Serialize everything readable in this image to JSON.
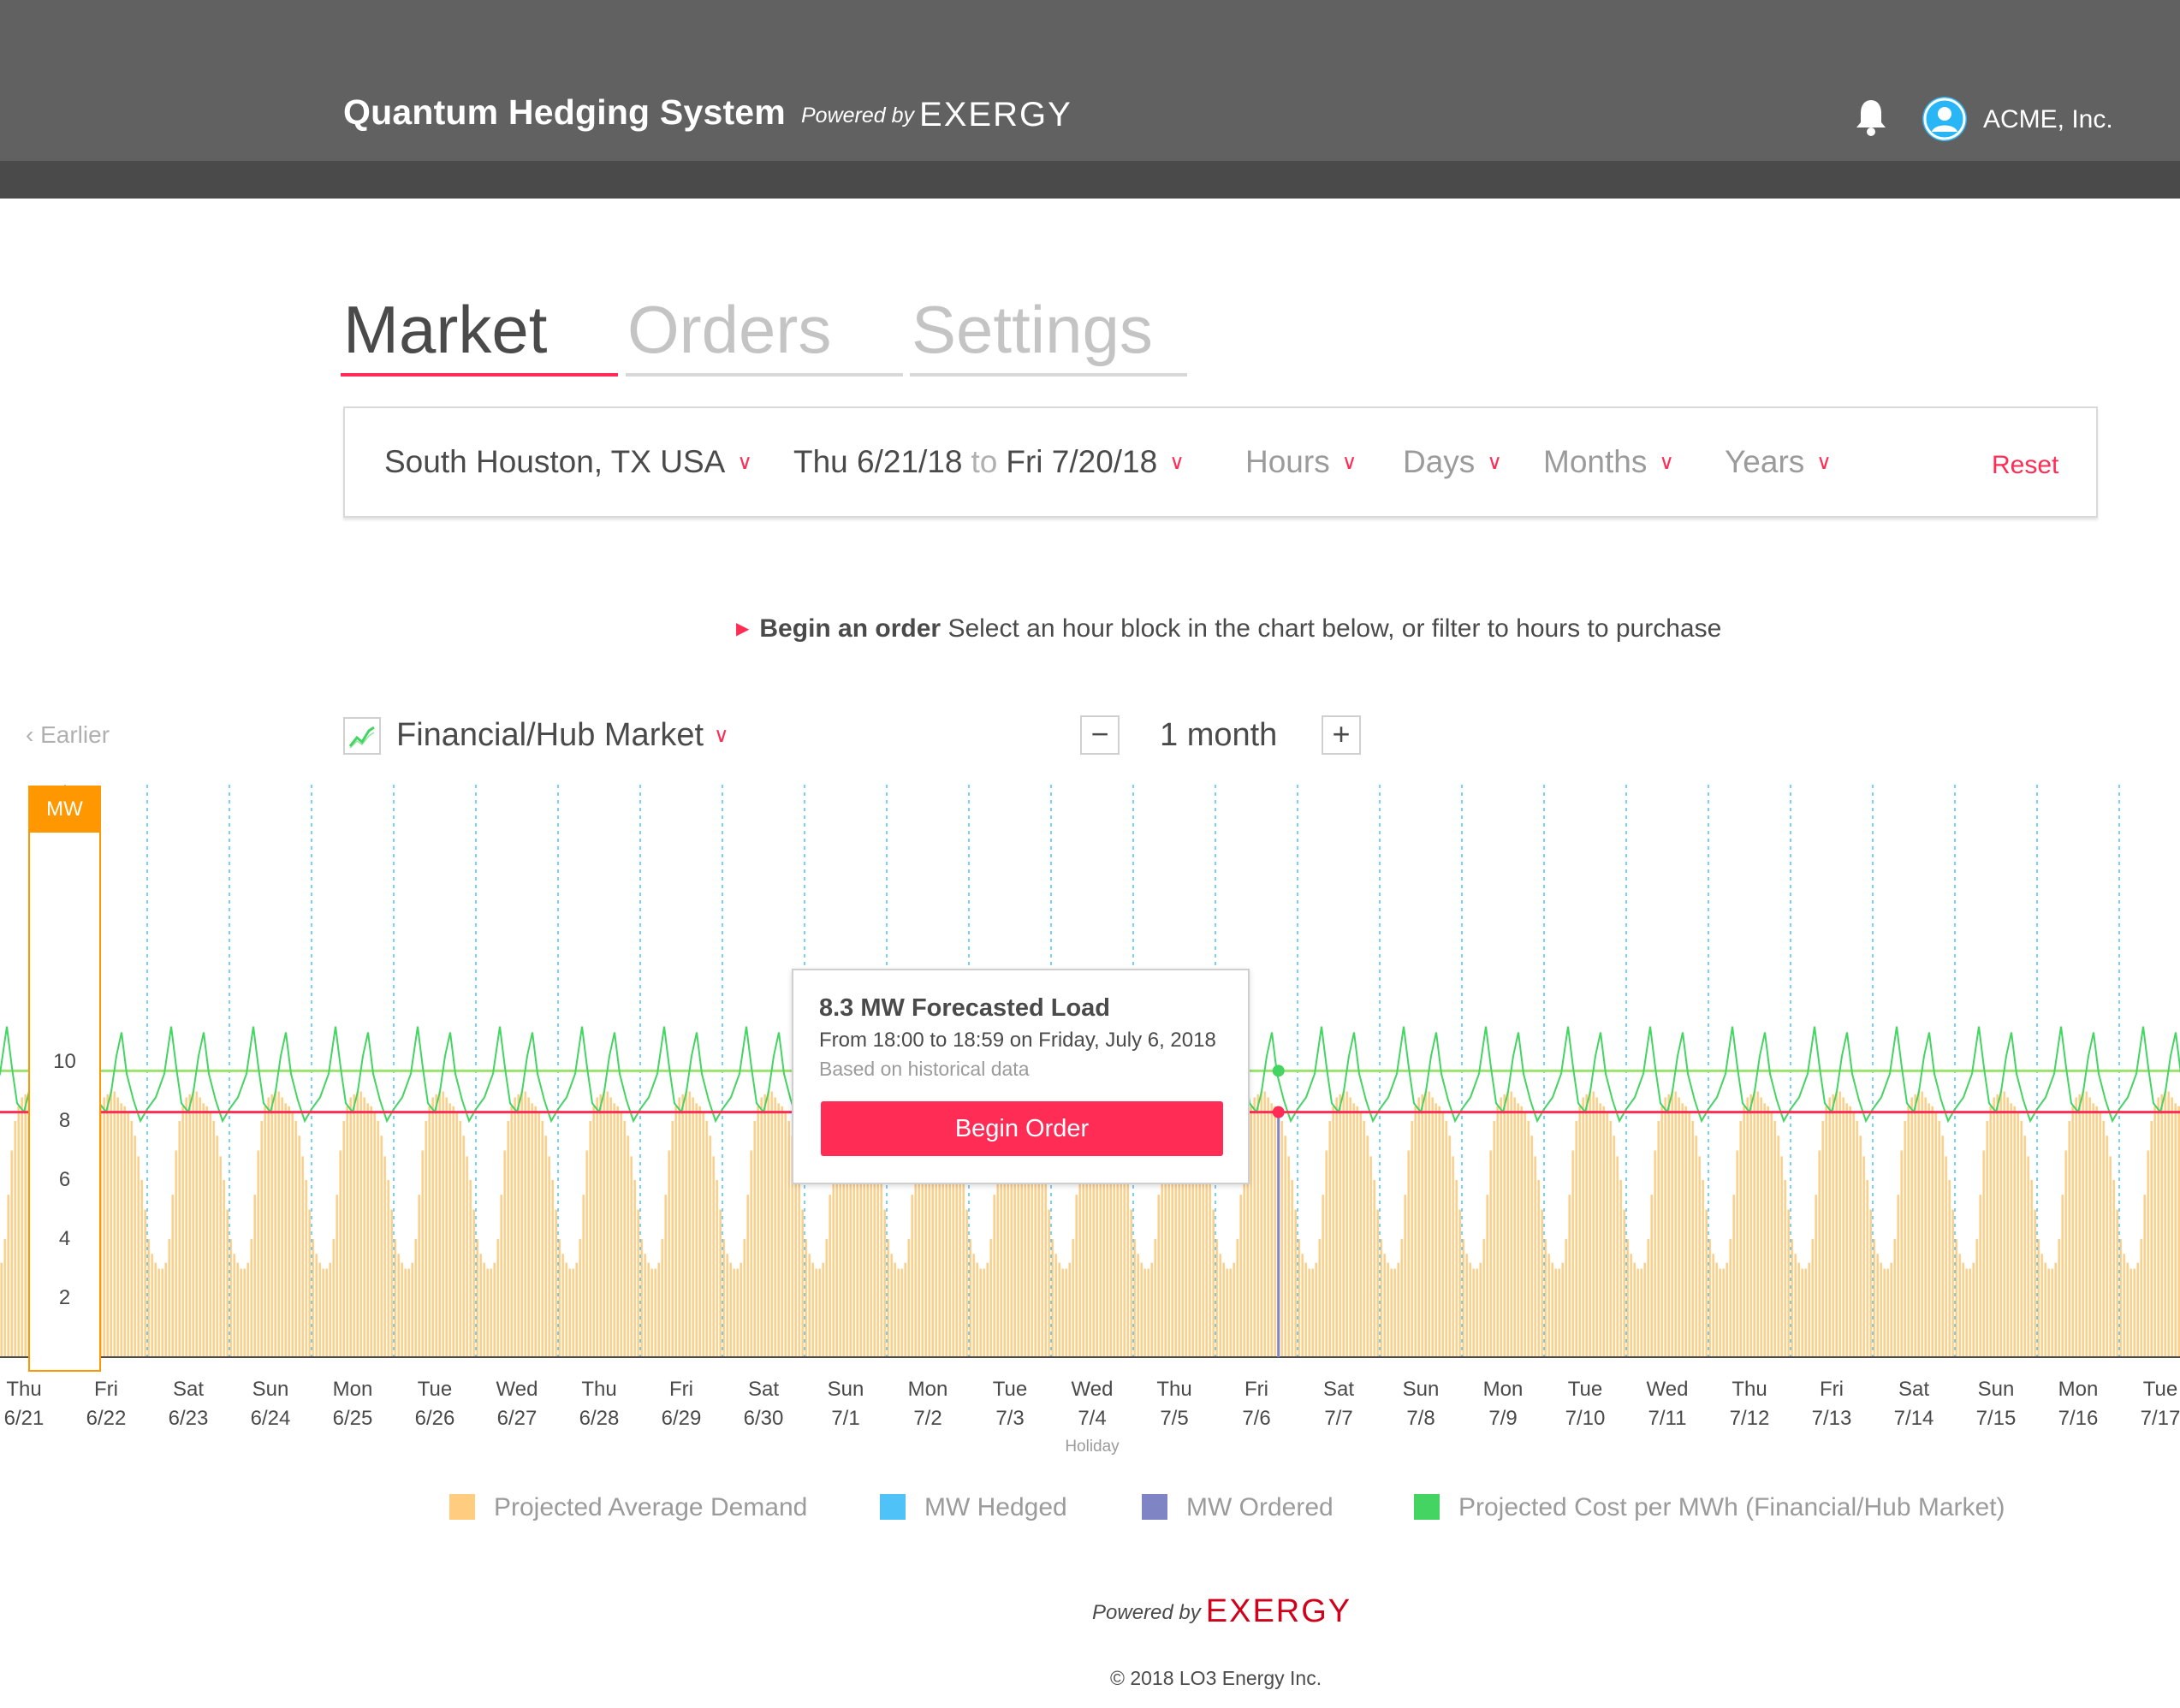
{
  "header": {
    "title": "Quantum Hedging System",
    "powered_prefix": "Powered by",
    "brand": "EXERGY",
    "account_name": "ACME, Inc.",
    "icons": [
      "bell-icon",
      "user-avatar-icon"
    ]
  },
  "tabs": [
    {
      "label": "Market",
      "active": true
    },
    {
      "label": "Orders",
      "active": false
    },
    {
      "label": "Settings",
      "active": false
    }
  ],
  "filter": {
    "location": "South Houston, TX USA",
    "date_from": "Thu 6/21/18",
    "date_sep": "to",
    "date_to": "Fri 7/20/18",
    "hours": "Hours",
    "days": "Days",
    "months": "Months",
    "years": "Years",
    "reset": "Reset"
  },
  "hint": {
    "bold": "Begin an order",
    "text": "Select an hour block in the chart below, or filter to hours to purchase"
  },
  "chart_controls": {
    "earlier": "Earlier",
    "market_select": "Financial/Hub Market",
    "zoom_minus": "−",
    "zoom_value": "1 month",
    "zoom_plus": "+"
  },
  "tooltip": {
    "title": "8.3 MW Forecasted Load",
    "subtitle": "From 18:00 to 18:59 on Friday, July 6, 2018",
    "note": "Based on historical data",
    "button": "Begin Order"
  },
  "chart_data": {
    "type": "bar",
    "y_axis_label": "MW",
    "ylim": [
      0,
      12
    ],
    "y_ticks": [
      2,
      4,
      6,
      8,
      10
    ],
    "grid": "vertical dashed day separators",
    "days": [
      {
        "dow": "Thu",
        "date": "6/21"
      },
      {
        "dow": "Fri",
        "date": "6/22"
      },
      {
        "dow": "Sat",
        "date": "6/23"
      },
      {
        "dow": "Sun",
        "date": "6/24"
      },
      {
        "dow": "Mon",
        "date": "6/25"
      },
      {
        "dow": "Tue",
        "date": "6/26"
      },
      {
        "dow": "Wed",
        "date": "6/27"
      },
      {
        "dow": "Thu",
        "date": "6/28"
      },
      {
        "dow": "Fri",
        "date": "6/29"
      },
      {
        "dow": "Sat",
        "date": "6/30"
      },
      {
        "dow": "Sun",
        "date": "7/1"
      },
      {
        "dow": "Mon",
        "date": "7/2"
      },
      {
        "dow": "Tue",
        "date": "7/3"
      },
      {
        "dow": "Wed",
        "date": "7/4",
        "note": "Holiday"
      },
      {
        "dow": "Thu",
        "date": "7/5"
      },
      {
        "dow": "Fri",
        "date": "7/6"
      },
      {
        "dow": "Sat",
        "date": "7/7"
      },
      {
        "dow": "Sun",
        "date": "7/8"
      },
      {
        "dow": "Mon",
        "date": "7/9"
      },
      {
        "dow": "Tue",
        "date": "7/10"
      },
      {
        "dow": "Wed",
        "date": "7/11"
      },
      {
        "dow": "Thu",
        "date": "7/12"
      },
      {
        "dow": "Fri",
        "date": "7/13"
      },
      {
        "dow": "Sat",
        "date": "7/14"
      },
      {
        "dow": "Sun",
        "date": "7/15"
      },
      {
        "dow": "Mon",
        "date": "7/16"
      },
      {
        "dow": "Tue",
        "date": "7/17"
      }
    ],
    "hourly_demand_profile_mw": [
      4.0,
      3.5,
      3.2,
      3.0,
      3.0,
      3.2,
      4.0,
      5.5,
      7.0,
      8.0,
      8.5,
      8.8,
      8.9,
      9.0,
      9.0,
      8.8,
      8.6,
      8.5,
      8.3,
      8.0,
      7.5,
      6.8,
      6.0,
      5.0
    ],
    "reference_lines_mw": {
      "projected_cost_level": 9.7,
      "selected_level": 8.3
    },
    "selected": {
      "day": "7/6",
      "hour": 18,
      "value_mw": 8.3
    },
    "legend": [
      {
        "label": "Projected Average Demand",
        "color": "#ffcc80"
      },
      {
        "label": "MW Hedged",
        "color": "#4fc3f7"
      },
      {
        "label": "MW Ordered",
        "color": "#7e84c4"
      },
      {
        "label": "Projected Cost per MWh (Financial/Hub Market)",
        "color": "#44d462"
      }
    ]
  },
  "footer": {
    "powered_prefix": "Powered by",
    "brand": "EXERGY",
    "copyright": "© 2018 LO3 Energy Inc."
  }
}
